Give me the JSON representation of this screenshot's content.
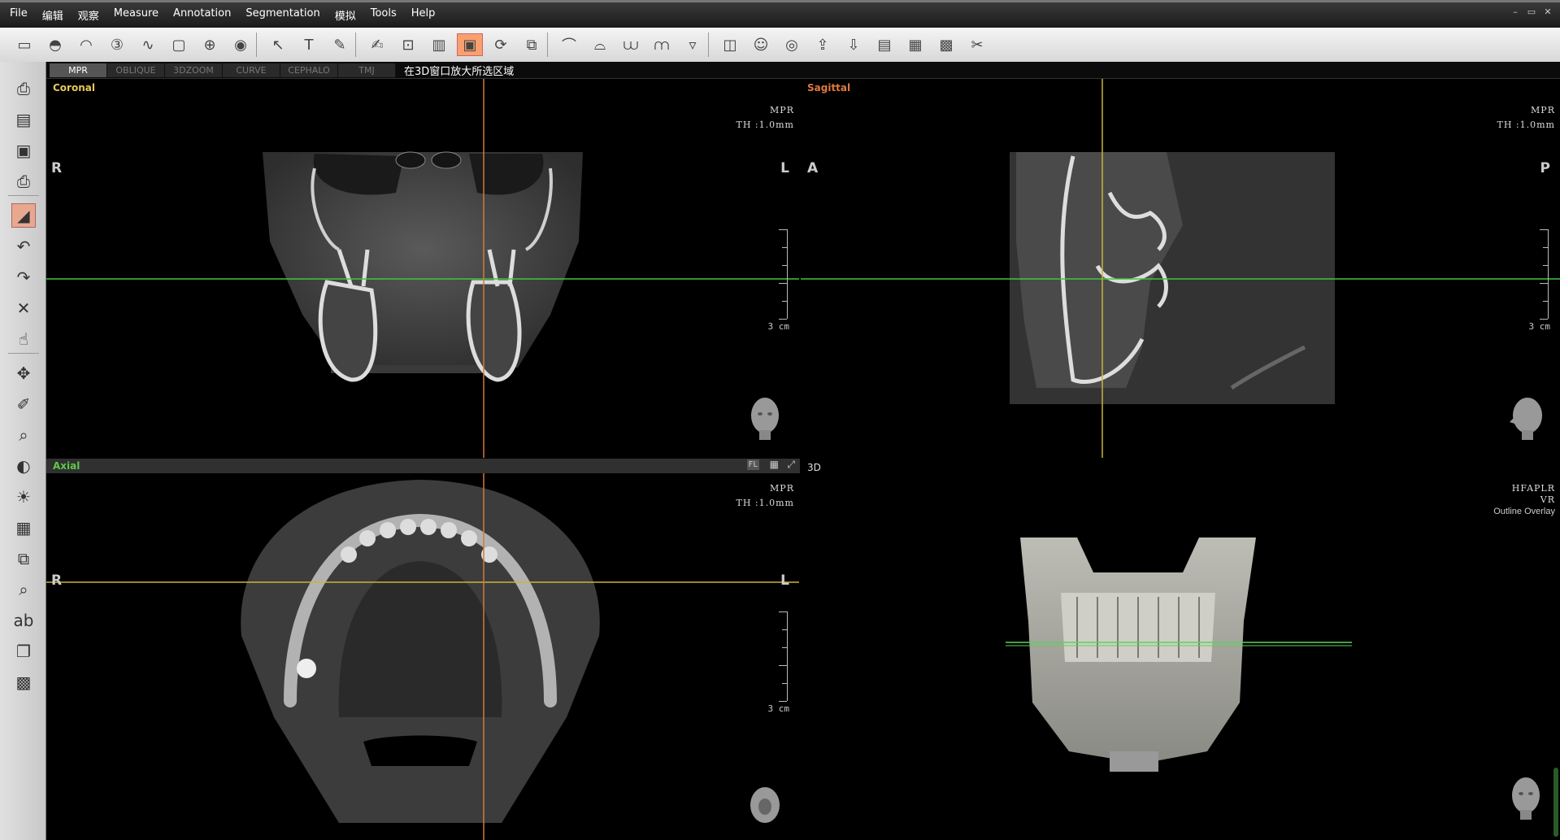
{
  "menu": [
    "File",
    "编辑",
    "观察",
    "Measure",
    "Annotation",
    "Segmentation",
    "模拟",
    "Tools",
    "Help"
  ],
  "window_controls": [
    "–",
    "▭",
    "✕"
  ],
  "toolbar_icons": [
    "ruler-icon",
    "implant-icon",
    "arch-icon",
    "3d-icon",
    "panoramic-icon",
    "crop-icon",
    "sphere-icon",
    "cylinder-icon",
    "pointer-icon",
    "text-icon",
    "pen-icon",
    "edit-report-icon",
    "zoom-region-icon",
    "histogram-icon",
    "overlay-icon",
    "sync-icon",
    "compare-icon",
    "curve-icon",
    "curve-m-icon",
    "teeth-icon",
    "teeth-m-icon",
    "cup-icon",
    "camera-icon",
    "person-icon",
    "disc-icon",
    "export-icon",
    "import-icon",
    "save-view-icon",
    "print-view-icon",
    "layout-icon",
    "settings-icon"
  ],
  "left_tools": [
    "print-icon",
    "open-icon",
    "save-icon",
    "printer-icon",
    "measure-triangle-icon",
    "undo-icon",
    "redo-icon",
    "delete-icon",
    "hand-icon",
    "move-icon",
    "pen-tool-icon",
    "zoom-icon",
    "contrast-icon",
    "brightness-icon",
    "gradient-icon",
    "layers-icon",
    "magnify-icon",
    "abc-icon",
    "copy-icon",
    "checker-icon"
  ],
  "tabs": [
    "MPR",
    "OBLIQUE",
    "3DZOOM",
    "CURVE",
    "CEPHALO",
    "TMJ"
  ],
  "hint": "在3D窗口放大所选区域",
  "viewports": {
    "coronal": {
      "label": "Coronal",
      "mpr": "MPR",
      "th": "TH :1.0mm",
      "left": "R",
      "right": "L",
      "scale": "3 cm",
      "label_color": "#e6c85a"
    },
    "sagittal": {
      "label": "Sagittal",
      "mpr": "MPR",
      "th": "TH :1.0mm",
      "left": "A",
      "right": "P",
      "scale": "3 cm",
      "label_color": "#e07a3c"
    },
    "axial": {
      "label": "Axial",
      "mpr": "MPR",
      "th": "TH :1.0mm",
      "left": "R",
      "right": "L",
      "scale": "3 cm",
      "label_color": "#5fc84a",
      "bar_buttons": [
        "FL",
        "▦",
        "⤢"
      ]
    },
    "vr": {
      "label": "3D",
      "orient": "HFAPLR",
      "mode": "VR",
      "overlay": "Outline Overlay"
    }
  },
  "colors": {
    "crosshair_orange": "#d2783c",
    "crosshair_green": "#3cc83c",
    "crosshair_yellow": "#c8b43c"
  }
}
